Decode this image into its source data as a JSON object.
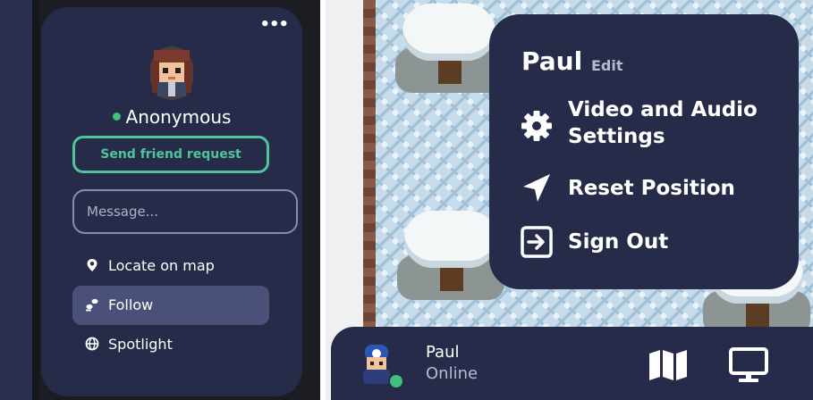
{
  "profile_card": {
    "more_label": "•••",
    "display_name": "Anonymous",
    "status_color": "#3ec17a",
    "friend_button_label": "Send friend request",
    "message_placeholder": "Message...",
    "actions": [
      {
        "label": "Locate on map",
        "icon": "map-pin-icon"
      },
      {
        "label": "Follow",
        "icon": "footsteps-icon",
        "active": true
      },
      {
        "label": "Spotlight",
        "icon": "globe-icon"
      }
    ]
  },
  "settings_menu": {
    "user_name": "Paul",
    "edit_label": "Edit",
    "items": [
      {
        "label": "Video and Audio Settings",
        "icon": "gear-icon"
      },
      {
        "label": "Reset Position",
        "icon": "navigation-arrow-icon"
      },
      {
        "label": "Sign Out",
        "icon": "sign-out-icon"
      }
    ]
  },
  "bottom_bar": {
    "user_name": "Paul",
    "status": "Online",
    "icons": [
      "map-icon",
      "screen-share-icon"
    ]
  },
  "colors": {
    "panel": "#262b49",
    "accent_green": "#4fc49a",
    "online_green": "#3ec17a"
  }
}
